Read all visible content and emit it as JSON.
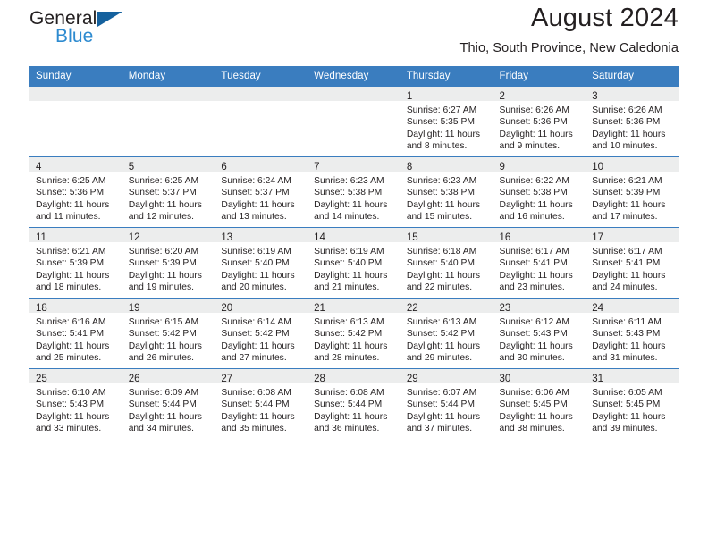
{
  "brand": {
    "name_part1": "General",
    "name_part2": "Blue",
    "flag_icon": "triangle-flag-icon"
  },
  "header": {
    "month_title": "August 2024",
    "location": "Thio, South Province, New Caledonia",
    "accent_color": "#3a7dbf",
    "band_color": "#eceded"
  },
  "weekdays": [
    "Sunday",
    "Monday",
    "Tuesday",
    "Wednesday",
    "Thursday",
    "Friday",
    "Saturday"
  ],
  "weeks": [
    [
      {
        "day": "",
        "sunrise": "",
        "sunset": "",
        "daylight_line1": "",
        "daylight_line2": ""
      },
      {
        "day": "",
        "sunrise": "",
        "sunset": "",
        "daylight_line1": "",
        "daylight_line2": ""
      },
      {
        "day": "",
        "sunrise": "",
        "sunset": "",
        "daylight_line1": "",
        "daylight_line2": ""
      },
      {
        "day": "",
        "sunrise": "",
        "sunset": "",
        "daylight_line1": "",
        "daylight_line2": ""
      },
      {
        "day": "1",
        "sunrise": "Sunrise: 6:27 AM",
        "sunset": "Sunset: 5:35 PM",
        "daylight_line1": "Daylight: 11 hours",
        "daylight_line2": "and 8 minutes."
      },
      {
        "day": "2",
        "sunrise": "Sunrise: 6:26 AM",
        "sunset": "Sunset: 5:36 PM",
        "daylight_line1": "Daylight: 11 hours",
        "daylight_line2": "and 9 minutes."
      },
      {
        "day": "3",
        "sunrise": "Sunrise: 6:26 AM",
        "sunset": "Sunset: 5:36 PM",
        "daylight_line1": "Daylight: 11 hours",
        "daylight_line2": "and 10 minutes."
      }
    ],
    [
      {
        "day": "4",
        "sunrise": "Sunrise: 6:25 AM",
        "sunset": "Sunset: 5:36 PM",
        "daylight_line1": "Daylight: 11 hours",
        "daylight_line2": "and 11 minutes."
      },
      {
        "day": "5",
        "sunrise": "Sunrise: 6:25 AM",
        "sunset": "Sunset: 5:37 PM",
        "daylight_line1": "Daylight: 11 hours",
        "daylight_line2": "and 12 minutes."
      },
      {
        "day": "6",
        "sunrise": "Sunrise: 6:24 AM",
        "sunset": "Sunset: 5:37 PM",
        "daylight_line1": "Daylight: 11 hours",
        "daylight_line2": "and 13 minutes."
      },
      {
        "day": "7",
        "sunrise": "Sunrise: 6:23 AM",
        "sunset": "Sunset: 5:38 PM",
        "daylight_line1": "Daylight: 11 hours",
        "daylight_line2": "and 14 minutes."
      },
      {
        "day": "8",
        "sunrise": "Sunrise: 6:23 AM",
        "sunset": "Sunset: 5:38 PM",
        "daylight_line1": "Daylight: 11 hours",
        "daylight_line2": "and 15 minutes."
      },
      {
        "day": "9",
        "sunrise": "Sunrise: 6:22 AM",
        "sunset": "Sunset: 5:38 PM",
        "daylight_line1": "Daylight: 11 hours",
        "daylight_line2": "and 16 minutes."
      },
      {
        "day": "10",
        "sunrise": "Sunrise: 6:21 AM",
        "sunset": "Sunset: 5:39 PM",
        "daylight_line1": "Daylight: 11 hours",
        "daylight_line2": "and 17 minutes."
      }
    ],
    [
      {
        "day": "11",
        "sunrise": "Sunrise: 6:21 AM",
        "sunset": "Sunset: 5:39 PM",
        "daylight_line1": "Daylight: 11 hours",
        "daylight_line2": "and 18 minutes."
      },
      {
        "day": "12",
        "sunrise": "Sunrise: 6:20 AM",
        "sunset": "Sunset: 5:39 PM",
        "daylight_line1": "Daylight: 11 hours",
        "daylight_line2": "and 19 minutes."
      },
      {
        "day": "13",
        "sunrise": "Sunrise: 6:19 AM",
        "sunset": "Sunset: 5:40 PM",
        "daylight_line1": "Daylight: 11 hours",
        "daylight_line2": "and 20 minutes."
      },
      {
        "day": "14",
        "sunrise": "Sunrise: 6:19 AM",
        "sunset": "Sunset: 5:40 PM",
        "daylight_line1": "Daylight: 11 hours",
        "daylight_line2": "and 21 minutes."
      },
      {
        "day": "15",
        "sunrise": "Sunrise: 6:18 AM",
        "sunset": "Sunset: 5:40 PM",
        "daylight_line1": "Daylight: 11 hours",
        "daylight_line2": "and 22 minutes."
      },
      {
        "day": "16",
        "sunrise": "Sunrise: 6:17 AM",
        "sunset": "Sunset: 5:41 PM",
        "daylight_line1": "Daylight: 11 hours",
        "daylight_line2": "and 23 minutes."
      },
      {
        "day": "17",
        "sunrise": "Sunrise: 6:17 AM",
        "sunset": "Sunset: 5:41 PM",
        "daylight_line1": "Daylight: 11 hours",
        "daylight_line2": "and 24 minutes."
      }
    ],
    [
      {
        "day": "18",
        "sunrise": "Sunrise: 6:16 AM",
        "sunset": "Sunset: 5:41 PM",
        "daylight_line1": "Daylight: 11 hours",
        "daylight_line2": "and 25 minutes."
      },
      {
        "day": "19",
        "sunrise": "Sunrise: 6:15 AM",
        "sunset": "Sunset: 5:42 PM",
        "daylight_line1": "Daylight: 11 hours",
        "daylight_line2": "and 26 minutes."
      },
      {
        "day": "20",
        "sunrise": "Sunrise: 6:14 AM",
        "sunset": "Sunset: 5:42 PM",
        "daylight_line1": "Daylight: 11 hours",
        "daylight_line2": "and 27 minutes."
      },
      {
        "day": "21",
        "sunrise": "Sunrise: 6:13 AM",
        "sunset": "Sunset: 5:42 PM",
        "daylight_line1": "Daylight: 11 hours",
        "daylight_line2": "and 28 minutes."
      },
      {
        "day": "22",
        "sunrise": "Sunrise: 6:13 AM",
        "sunset": "Sunset: 5:42 PM",
        "daylight_line1": "Daylight: 11 hours",
        "daylight_line2": "and 29 minutes."
      },
      {
        "day": "23",
        "sunrise": "Sunrise: 6:12 AM",
        "sunset": "Sunset: 5:43 PM",
        "daylight_line1": "Daylight: 11 hours",
        "daylight_line2": "and 30 minutes."
      },
      {
        "day": "24",
        "sunrise": "Sunrise: 6:11 AM",
        "sunset": "Sunset: 5:43 PM",
        "daylight_line1": "Daylight: 11 hours",
        "daylight_line2": "and 31 minutes."
      }
    ],
    [
      {
        "day": "25",
        "sunrise": "Sunrise: 6:10 AM",
        "sunset": "Sunset: 5:43 PM",
        "daylight_line1": "Daylight: 11 hours",
        "daylight_line2": "and 33 minutes."
      },
      {
        "day": "26",
        "sunrise": "Sunrise: 6:09 AM",
        "sunset": "Sunset: 5:44 PM",
        "daylight_line1": "Daylight: 11 hours",
        "daylight_line2": "and 34 minutes."
      },
      {
        "day": "27",
        "sunrise": "Sunrise: 6:08 AM",
        "sunset": "Sunset: 5:44 PM",
        "daylight_line1": "Daylight: 11 hours",
        "daylight_line2": "and 35 minutes."
      },
      {
        "day": "28",
        "sunrise": "Sunrise: 6:08 AM",
        "sunset": "Sunset: 5:44 PM",
        "daylight_line1": "Daylight: 11 hours",
        "daylight_line2": "and 36 minutes."
      },
      {
        "day": "29",
        "sunrise": "Sunrise: 6:07 AM",
        "sunset": "Sunset: 5:44 PM",
        "daylight_line1": "Daylight: 11 hours",
        "daylight_line2": "and 37 minutes."
      },
      {
        "day": "30",
        "sunrise": "Sunrise: 6:06 AM",
        "sunset": "Sunset: 5:45 PM",
        "daylight_line1": "Daylight: 11 hours",
        "daylight_line2": "and 38 minutes."
      },
      {
        "day": "31",
        "sunrise": "Sunrise: 6:05 AM",
        "sunset": "Sunset: 5:45 PM",
        "daylight_line1": "Daylight: 11 hours",
        "daylight_line2": "and 39 minutes."
      }
    ]
  ]
}
